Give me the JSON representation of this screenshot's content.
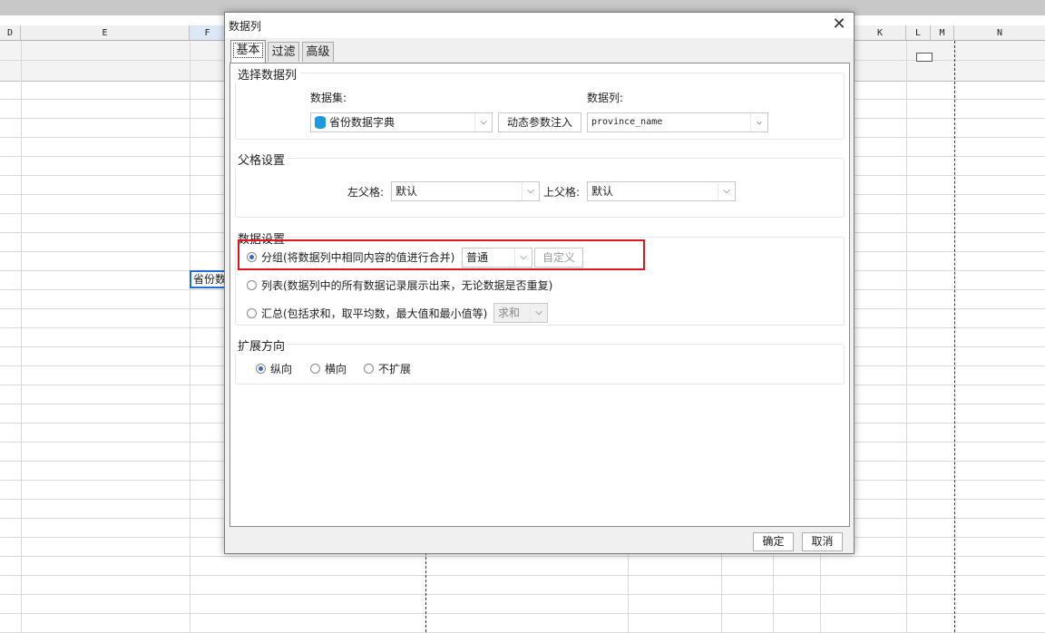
{
  "sheet": {
    "columns": [
      "D",
      "E",
      "F",
      "K",
      "L",
      "M",
      "N"
    ],
    "cell_text": "省份数"
  },
  "dialog": {
    "title": "数据列",
    "tabs": [
      {
        "label": "基本",
        "active": true
      },
      {
        "label": "过滤",
        "active": false
      },
      {
        "label": "高级",
        "active": false
      }
    ],
    "select_column": {
      "title": "选择数据列",
      "dataset_label": "数据集:",
      "dataset_value": "省份数据字典",
      "dynamic_param_button": "动态参数注入",
      "column_label": "数据列:",
      "column_value": "province_name"
    },
    "parent_settings": {
      "title": "父格设置",
      "left_parent_label": "左父格:",
      "left_parent_value": "默认",
      "top_parent_label": "上父格:",
      "top_parent_value": "默认"
    },
    "data_settings": {
      "title": "数据设置",
      "group_option": "分组(将数据列中相同内容的值进行合并)",
      "group_mode_value": "普通",
      "custom_button": "自定义",
      "list_option": "列表(数据列中的所有数据记录展示出来，无论数据是否重复)",
      "summary_option": "汇总(包括求和，取平均数，最大值和最小值等)",
      "summary_value": "求和",
      "selected": "group"
    },
    "expand": {
      "title": "扩展方向",
      "options": [
        "纵向",
        "横向",
        "不扩展"
      ],
      "selected": "纵向"
    },
    "ok_button": "确定",
    "cancel_button": "取消"
  },
  "colors": {
    "highlight": "#e3141c",
    "radio_dot": "#3069c8",
    "selection": "#1e6fd9"
  }
}
